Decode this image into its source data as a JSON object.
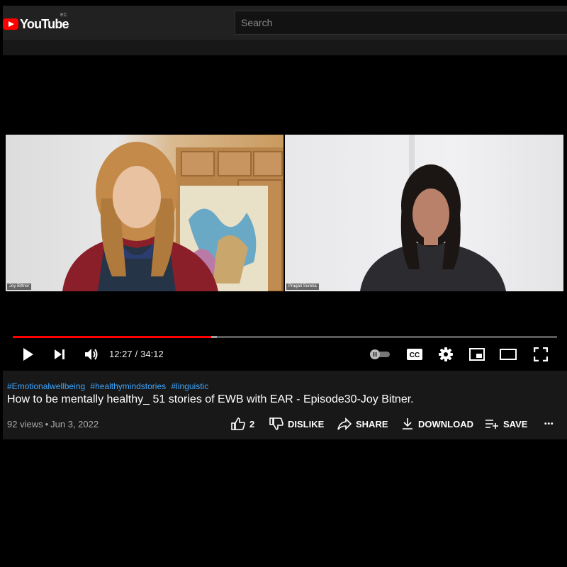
{
  "header": {
    "logo_text": "YouTube",
    "region_code": "EC",
    "search_placeholder": "Search"
  },
  "player": {
    "participants": [
      "Joy Bittner",
      "Pragati Sureka"
    ],
    "current_time": "12:27",
    "separator": "/",
    "duration": "34:12",
    "progress_fraction": 0.3642,
    "buffered_fraction": 0.375,
    "progress_color": "#ff0000",
    "icons": [
      "play-icon",
      "next-icon",
      "volume-icon",
      "autoplay-toggle-icon",
      "captions-icon",
      "settings-icon",
      "miniplayer-icon",
      "theater-icon",
      "fullscreen-icon"
    ]
  },
  "video": {
    "hashtags": [
      "#Emotionalwellbeing",
      "#healthymindstories",
      "#linguistic"
    ],
    "title": "How to be mentally healthy_ 51 stories of EWB with EAR - Episode30-Joy Bitner.",
    "views": "92 views",
    "date": "Jun 3, 2022",
    "link_color": "#3ea6ff"
  },
  "actions": {
    "likes": "2",
    "dislike": "DISLIKE",
    "share": "SHARE",
    "download": "DOWNLOAD",
    "save": "SAVE",
    "more": "•••"
  }
}
